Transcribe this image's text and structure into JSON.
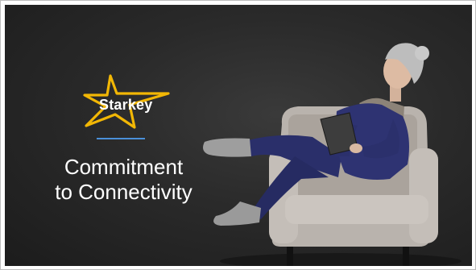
{
  "slide": {
    "logo_text": "Starkey",
    "title_line1": "Commitment",
    "title_line2": "to Connectivity"
  },
  "colors": {
    "background": "#262626",
    "accent_blue": "#4a90d9",
    "star_gold": "#f2b705",
    "text": "#ffffff"
  },
  "icons": [
    "starkey-star-logo"
  ]
}
